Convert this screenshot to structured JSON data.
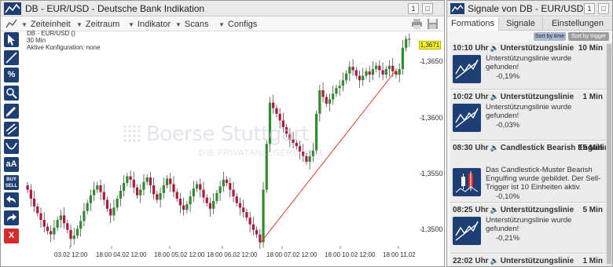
{
  "chart_window": {
    "title": "DB - EUR/USD - Deutsche Bank Indikation",
    "buttons": [
      "1",
      "□"
    ],
    "menu": [
      "Zeiteinheit",
      "Zeitraum",
      "Indikator",
      "Scans",
      "Configs"
    ],
    "legend": [
      "DB - EUR/USD ()",
      "30 Min",
      "Aktive Konfiguration: none"
    ],
    "toolbar": [
      {
        "icon": "cursor-arrow-icon",
        "label": ""
      },
      {
        "icon": "trend-line-icon",
        "label": ""
      },
      {
        "icon": "percent-icon",
        "label": "%"
      },
      {
        "icon": "search-icon",
        "label": ""
      },
      {
        "icon": "pencil-icon",
        "label": ""
      },
      {
        "icon": "parallel-lines-icon",
        "label": ""
      },
      {
        "icon": "arc-icon",
        "label": ""
      },
      {
        "icon": "text-size-icon",
        "label": "aA"
      },
      {
        "icon": "buy-sell-icon",
        "label": "BUY SELL"
      },
      {
        "icon": "undo-icon",
        "label": ""
      },
      {
        "icon": "redo-icon",
        "label": ""
      },
      {
        "icon": "delete-icon",
        "label": "X"
      }
    ],
    "watermark": {
      "brand": "Boerse Stuttgart",
      "tagline": "DIE PRIVATANLEGERBÖRSE"
    },
    "last_price": "1,3671"
  },
  "chart_data": {
    "type": "candlestick",
    "y_ticks": [
      "1,3650",
      "1,3600",
      "1,3550",
      "1,3500"
    ],
    "y_tick_values": [
      1.365,
      1.36,
      1.355,
      1.35
    ],
    "ylim": [
      1.3483,
      1.3677
    ],
    "x_ticks": [
      "03.02 12:00",
      "18:00 04.02 12:00",
      "18:00 05.02 12:00",
      "18:00 06.02 12:00",
      "18:00 07.02 12:00",
      "18:00 10.02 12:00",
      "18:00 11.02"
    ],
    "up_color": "#2e8b2e",
    "down_color": "#b0173d",
    "trendline": {
      "color": "#d9412b",
      "from": 1.3488,
      "to": 1.3643
    },
    "series": [
      1.3536,
      1.3528,
      1.3521,
      1.3515,
      1.3509,
      1.3503,
      1.3499,
      1.3496,
      1.3502,
      1.3509,
      1.3513,
      1.3506,
      1.35,
      1.3492,
      1.3495,
      1.3501,
      1.3508,
      1.3517,
      1.3524,
      1.3531,
      1.3536,
      1.354,
      1.3534,
      1.3527,
      1.3519,
      1.3513,
      1.352,
      1.3528,
      1.3535,
      1.3542,
      1.3548,
      1.3545,
      1.3538,
      1.3531,
      1.3536,
      1.3543,
      1.3547,
      1.354,
      1.3532,
      1.3527,
      1.3533,
      1.354,
      1.3546,
      1.3541,
      1.3534,
      1.3528,
      1.3522,
      1.3518,
      1.3523,
      1.353,
      1.3537,
      1.3541,
      1.3536,
      1.3529,
      1.3524,
      1.3519,
      1.3526,
      1.3533,
      1.3539,
      1.3545,
      1.3542,
      1.3536,
      1.353,
      1.3524,
      1.352,
      1.3516,
      1.3511,
      1.3505,
      1.35,
      1.3496,
      1.3489,
      1.3536,
      1.3577,
      1.3614,
      1.3609,
      1.3604,
      1.3598,
      1.3592,
      1.3586,
      1.3581,
      1.3578,
      1.3575,
      1.357,
      1.3566,
      1.3561,
      1.3566,
      1.3571,
      1.3604,
      1.3625,
      1.3619,
      1.3613,
      1.3617,
      1.3622,
      1.3627,
      1.3629,
      1.3634,
      1.364,
      1.3646,
      1.3643,
      1.3638,
      1.3634,
      1.3638,
      1.3642,
      1.3639,
      1.3644,
      1.3647,
      1.3643,
      1.3639,
      1.3644,
      1.3647,
      1.3642,
      1.3639,
      1.3644,
      1.3663,
      1.3671,
      1.3671
    ]
  },
  "signals_window": {
    "title": "Signale von DB - EUR/USD",
    "buttons": [
      "1",
      "□"
    ],
    "tabs": [
      "Formations",
      "Signale",
      "Einstellungen"
    ],
    "sort": [
      "Sort by time",
      "Sort by trigger"
    ],
    "items": [
      {
        "time": "10:10 Uhr",
        "name": "Unterstützungslinie",
        "interval": "10 Min",
        "icon": "support-line-icon",
        "text": "Unterstützungslinie wurde gefunden!",
        "change": "-0,19%"
      },
      {
        "time": "10:02 Uhr",
        "name": "Unterstützungslinie",
        "interval": "1 Min",
        "icon": "support-line-icon",
        "text": "Unterstützungslinie wurde gefunden!",
        "change": "-0,03%"
      },
      {
        "time": "08:30 Uhr",
        "name": "Candlestick Bearish Engulfing",
        "interval": "15 Min",
        "icon": "bearish-engulfing-icon",
        "text": "Das Candlestick-Muster Bearish Engulfing wurde gebildet. Der Sell-Trigger ist 10 Einheiten aktiv.",
        "change": "-0,10%"
      },
      {
        "time": "08:25 Uhr",
        "name": "Unterstützungslinie",
        "interval": "5 Min",
        "icon": "support-line-icon",
        "text": "Unterstützungslinie wurde gefunden!",
        "change": "-0,21%"
      },
      {
        "time": "22:02 Uhr",
        "name": "Unterstützungslinie",
        "interval": "1 Min",
        "icon": "support-line-icon",
        "text": "",
        "change": ""
      }
    ]
  },
  "colors": {
    "toolbar": "#1e3f74",
    "delete": "#d82a2a",
    "last_price_bg": "#f5f52a"
  }
}
